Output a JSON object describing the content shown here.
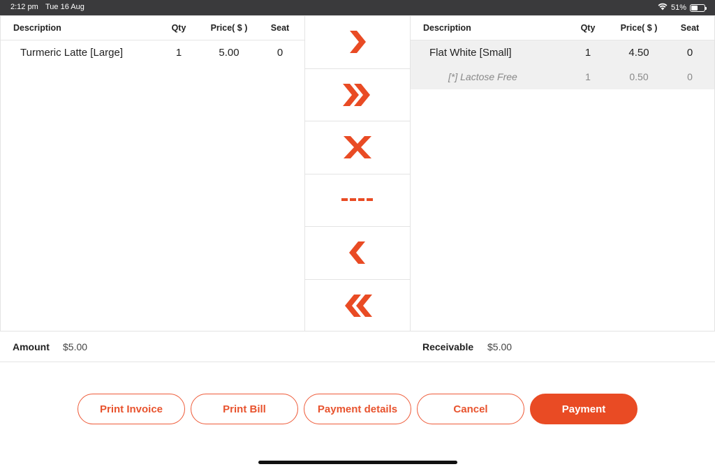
{
  "status_bar": {
    "time": "2:12 pm",
    "date": "Tue 16 Aug",
    "battery": "51%",
    "battery_level": 0.51
  },
  "columns": {
    "description": "Description",
    "qty": "Qty",
    "price": "Price( $ )",
    "seat": "Seat"
  },
  "left_items": [
    {
      "description": "Turmeric Latte  [Large]",
      "qty": "1",
      "price": "5.00",
      "seat": "0"
    }
  ],
  "right_items": [
    {
      "description": "Flat White  [Small]",
      "qty": "1",
      "price": "4.50",
      "seat": "0"
    },
    {
      "description": "[*] Lactose Free",
      "qty": "1",
      "price": "0.50",
      "seat": "0"
    }
  ],
  "controls": [
    "move-right-icon",
    "move-all-right-icon",
    "remove-icon",
    "split-icon",
    "move-left-icon",
    "move-all-left-icon"
  ],
  "summary": {
    "amount_label": "Amount",
    "amount_value": "$5.00",
    "receivable_label": "Receivable",
    "receivable_value": "$5.00"
  },
  "buttons": {
    "print_invoice": "Print Invoice",
    "print_bill": "Print Bill",
    "payment_details": "Payment details",
    "cancel": "Cancel",
    "payment": "Payment"
  },
  "colors": {
    "accent": "#e94b24",
    "status_bar": "#3a3a3c"
  }
}
